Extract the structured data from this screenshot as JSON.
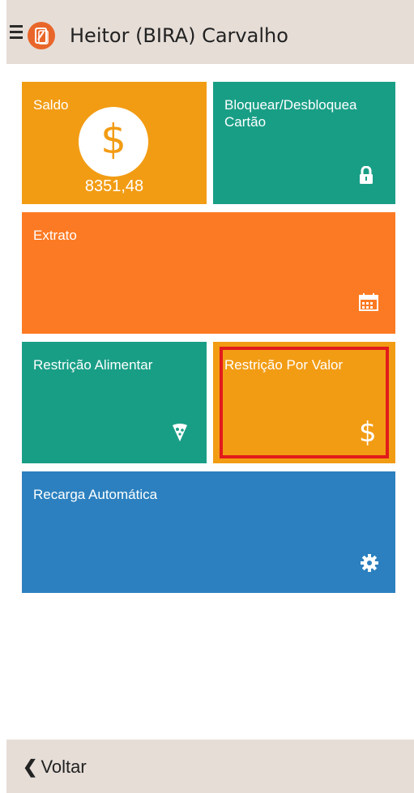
{
  "header": {
    "menu_icon": "hamburger-menu-icon",
    "logo_icon": "card-logo-icon",
    "user_name": "Heitor (BIRA) Carvalho"
  },
  "tiles": {
    "saldo": {
      "label": "Saldo",
      "value": "8351,48",
      "icon": "dollar-coin-icon",
      "color": "#f29c14"
    },
    "bloquear": {
      "label": "Bloquear/Desbloquea Cartão",
      "icon": "lock-icon",
      "color": "#199e86"
    },
    "extrato": {
      "label": "Extrato",
      "icon": "calendar-icon",
      "color": "#fc7a23"
    },
    "restricao_alimentar": {
      "label": "Restrição Alimentar",
      "icon": "pizza-slice-icon",
      "color": "#199e86"
    },
    "restricao_valor": {
      "label": "Restrição Por Valor",
      "icon": "dollar-icon",
      "color": "#f29c14",
      "highlight_color": "#e11b1b"
    },
    "recarga": {
      "label": "Recarga Automática",
      "icon": "gear-icon",
      "color": "#2c80bf"
    }
  },
  "footer": {
    "back_icon": "chevron-left-icon",
    "back_label": "Voltar"
  }
}
